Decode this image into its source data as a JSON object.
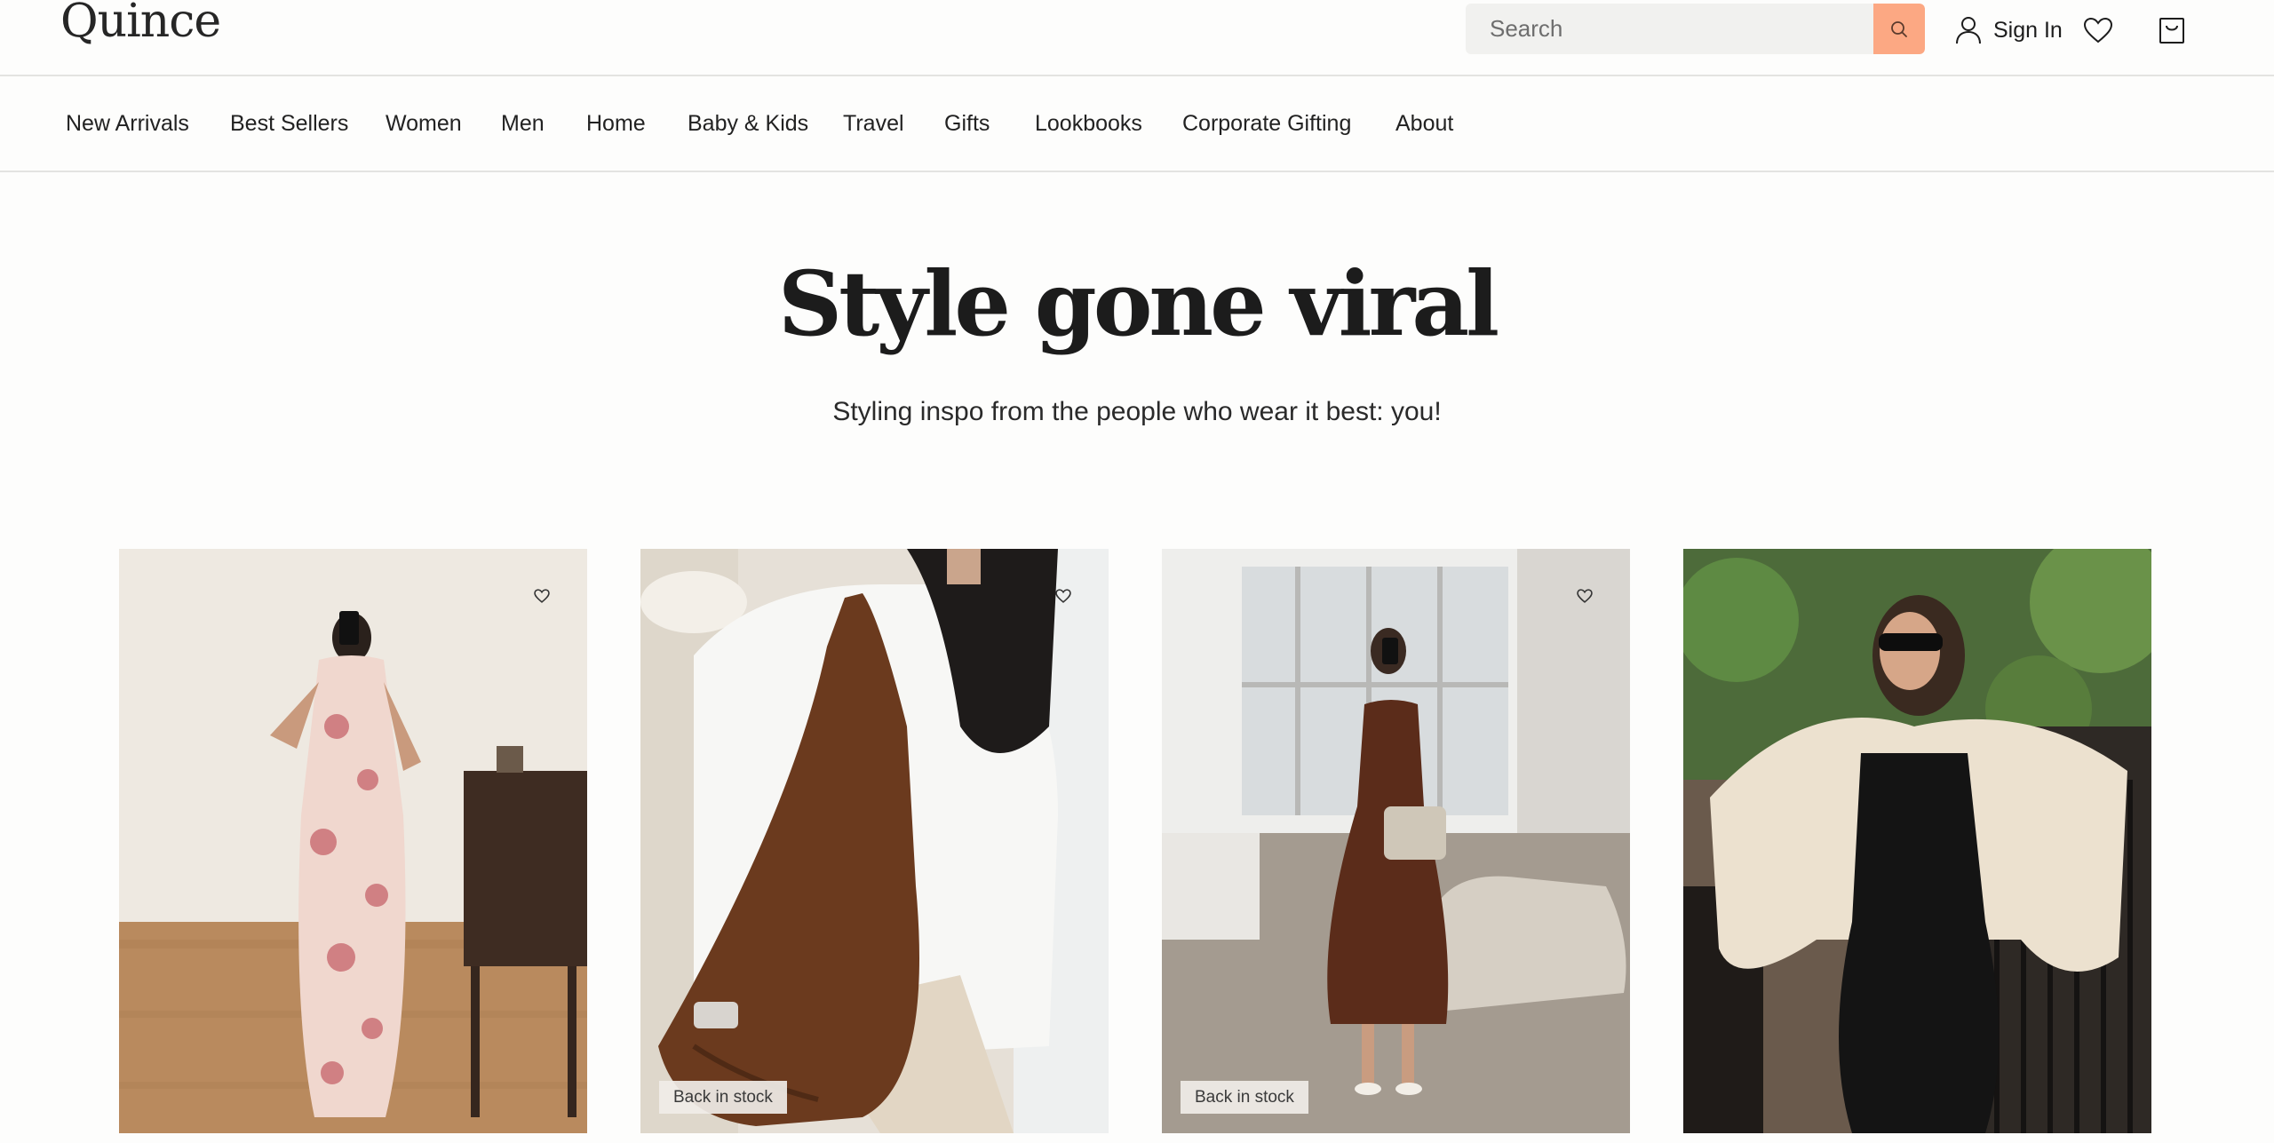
{
  "header": {
    "logo": "Quince",
    "search_placeholder": "Search",
    "sign_in_label": "Sign In"
  },
  "nav": {
    "items": [
      "New Arrivals",
      "Best Sellers",
      "Women",
      "Men",
      "Home",
      "Baby & Kids",
      "Travel",
      "Gifts",
      "Lookbooks",
      "Corporate Gifting",
      "About"
    ]
  },
  "hero": {
    "title": "Style gone viral",
    "subtitle": "Styling inspo from the people who wear it best: you!"
  },
  "cards": [
    {
      "badge": ""
    },
    {
      "badge": "Back in stock"
    },
    {
      "badge": "Back in stock"
    },
    {
      "badge": ""
    }
  ],
  "colors": {
    "search_button": "#fca883",
    "page_bg": "#fdfdfc",
    "divider": "#e3e3e1"
  }
}
